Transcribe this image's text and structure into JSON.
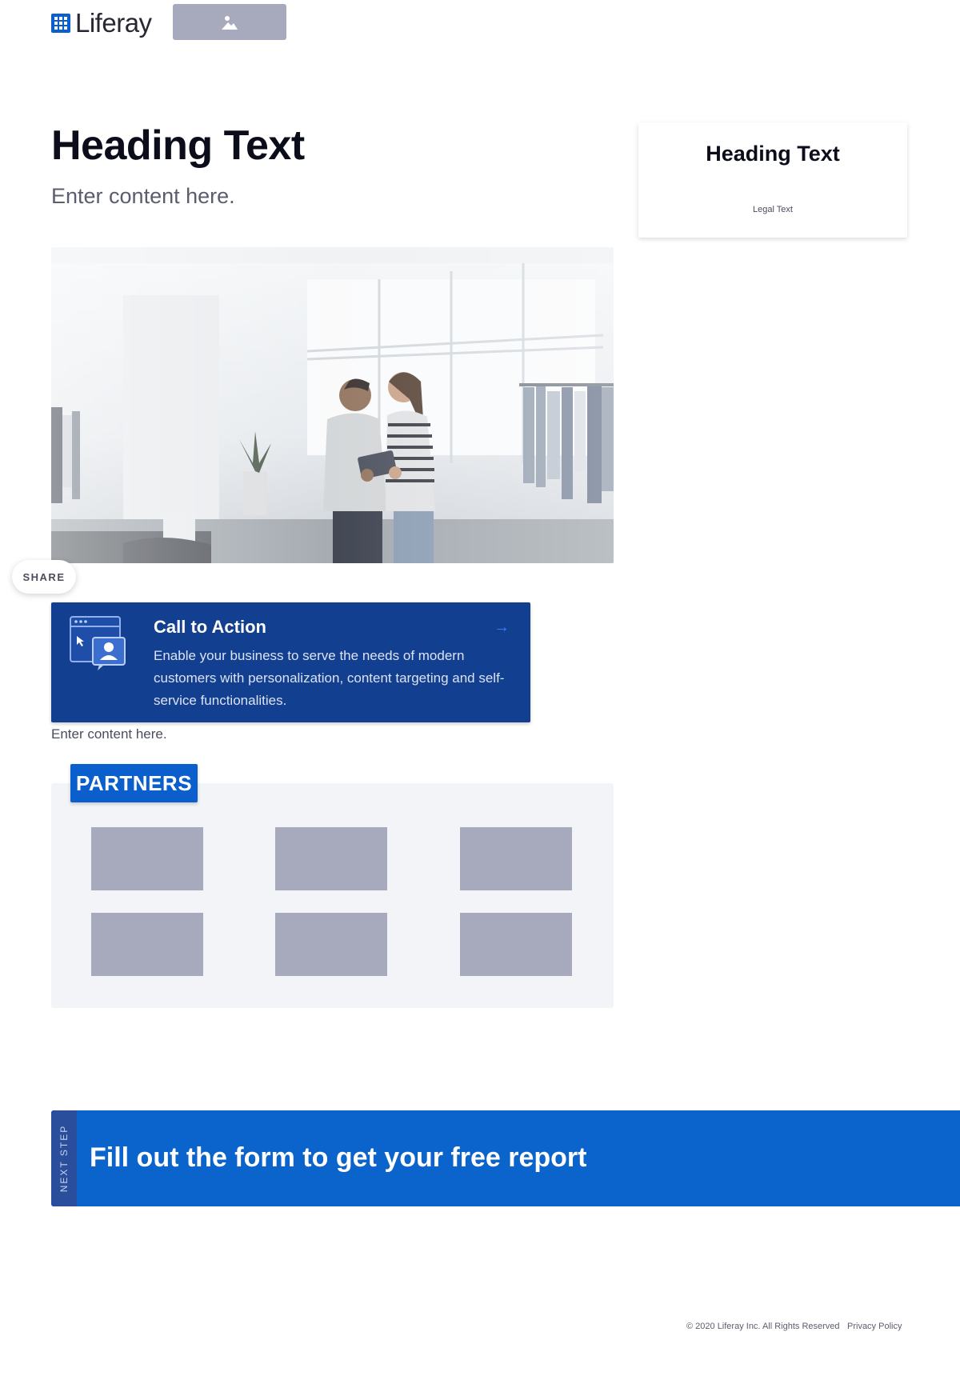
{
  "header": {
    "logo_text": "Liferay",
    "logo_icon": "liferay-logo-icon",
    "image_placeholder_icon": "image-placeholder-icon"
  },
  "main": {
    "heading": "Heading Text",
    "subtext": "Enter content here."
  },
  "side_card": {
    "heading": "Heading Text",
    "legal": "Legal Text"
  },
  "share": {
    "label": "SHARE"
  },
  "cta": {
    "title": "Call to Action",
    "body": "Enable your business to serve the needs of modern customers with personalization, content targeting and self-service functionalities.",
    "arrow": "→",
    "icon": "browser-user-icon"
  },
  "content_text": "Enter content here.",
  "partners": {
    "badge": "PARTNERS",
    "logo_count": 6
  },
  "next_step": {
    "tab_label": "NEXT STEP",
    "title": "Fill out the form to get your free report"
  },
  "footer": {
    "copyright": "© 2020 Liferay Inc. All Rights Reserved",
    "privacy": "Privacy Policy"
  },
  "colors": {
    "primary": "#0b5fcc",
    "cta_bg": "#123f8f",
    "next_step_bg": "#0b63cc",
    "placeholder": "#a7a9bc"
  }
}
